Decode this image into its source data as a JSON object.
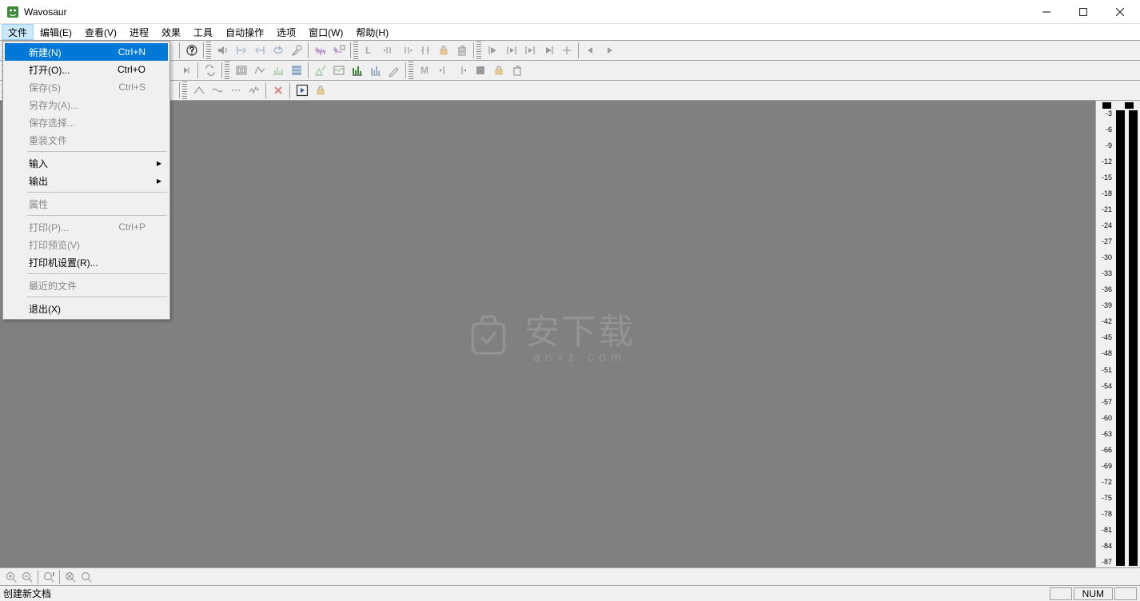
{
  "window": {
    "title": "Wavosaur"
  },
  "menubar": [
    "文件",
    "编辑(E)",
    "查看(V)",
    "进程",
    "效果",
    "工具",
    "自动操作",
    "选项",
    "窗口(W)",
    "帮助(H)"
  ],
  "file_menu": {
    "items": [
      {
        "label": "新建(N)",
        "shortcut": "Ctrl+N",
        "highlight": true
      },
      {
        "label": "打开(O)...",
        "shortcut": "Ctrl+O"
      },
      {
        "label": "保存(S)",
        "shortcut": "Ctrl+S",
        "disabled": true
      },
      {
        "label": "另存为(A)...",
        "disabled": true
      },
      {
        "label": "保存选择...",
        "disabled": true
      },
      {
        "label": "重装文件",
        "disabled": true
      },
      {
        "sep": true
      },
      {
        "label": "输入",
        "submenu": true
      },
      {
        "label": "输出",
        "submenu": true
      },
      {
        "sep": true
      },
      {
        "label": "属性",
        "disabled": true
      },
      {
        "sep": true
      },
      {
        "label": "打印(P)...",
        "shortcut": "Ctrl+P",
        "disabled": true
      },
      {
        "label": "打印预览(V)",
        "disabled": true
      },
      {
        "label": "打印机设置(R)..."
      },
      {
        "sep": true
      },
      {
        "label": "最近的文件",
        "disabled": true
      },
      {
        "sep": true
      },
      {
        "label": "退出(X)"
      }
    ]
  },
  "meter": {
    "scale": [
      "-3",
      "-6",
      "-9",
      "-12",
      "-15",
      "-18",
      "-21",
      "-24",
      "-27",
      "-30",
      "-33",
      "-36",
      "-39",
      "-42",
      "-45",
      "-48",
      "-51",
      "-54",
      "-57",
      "-60",
      "-63",
      "-66",
      "-69",
      "-72",
      "-75",
      "-78",
      "-81",
      "-84",
      "-87"
    ]
  },
  "watermark": {
    "main": "安下载",
    "sub": "anxz.com"
  },
  "status": {
    "text": "创建新文档",
    "num": "NUM"
  }
}
